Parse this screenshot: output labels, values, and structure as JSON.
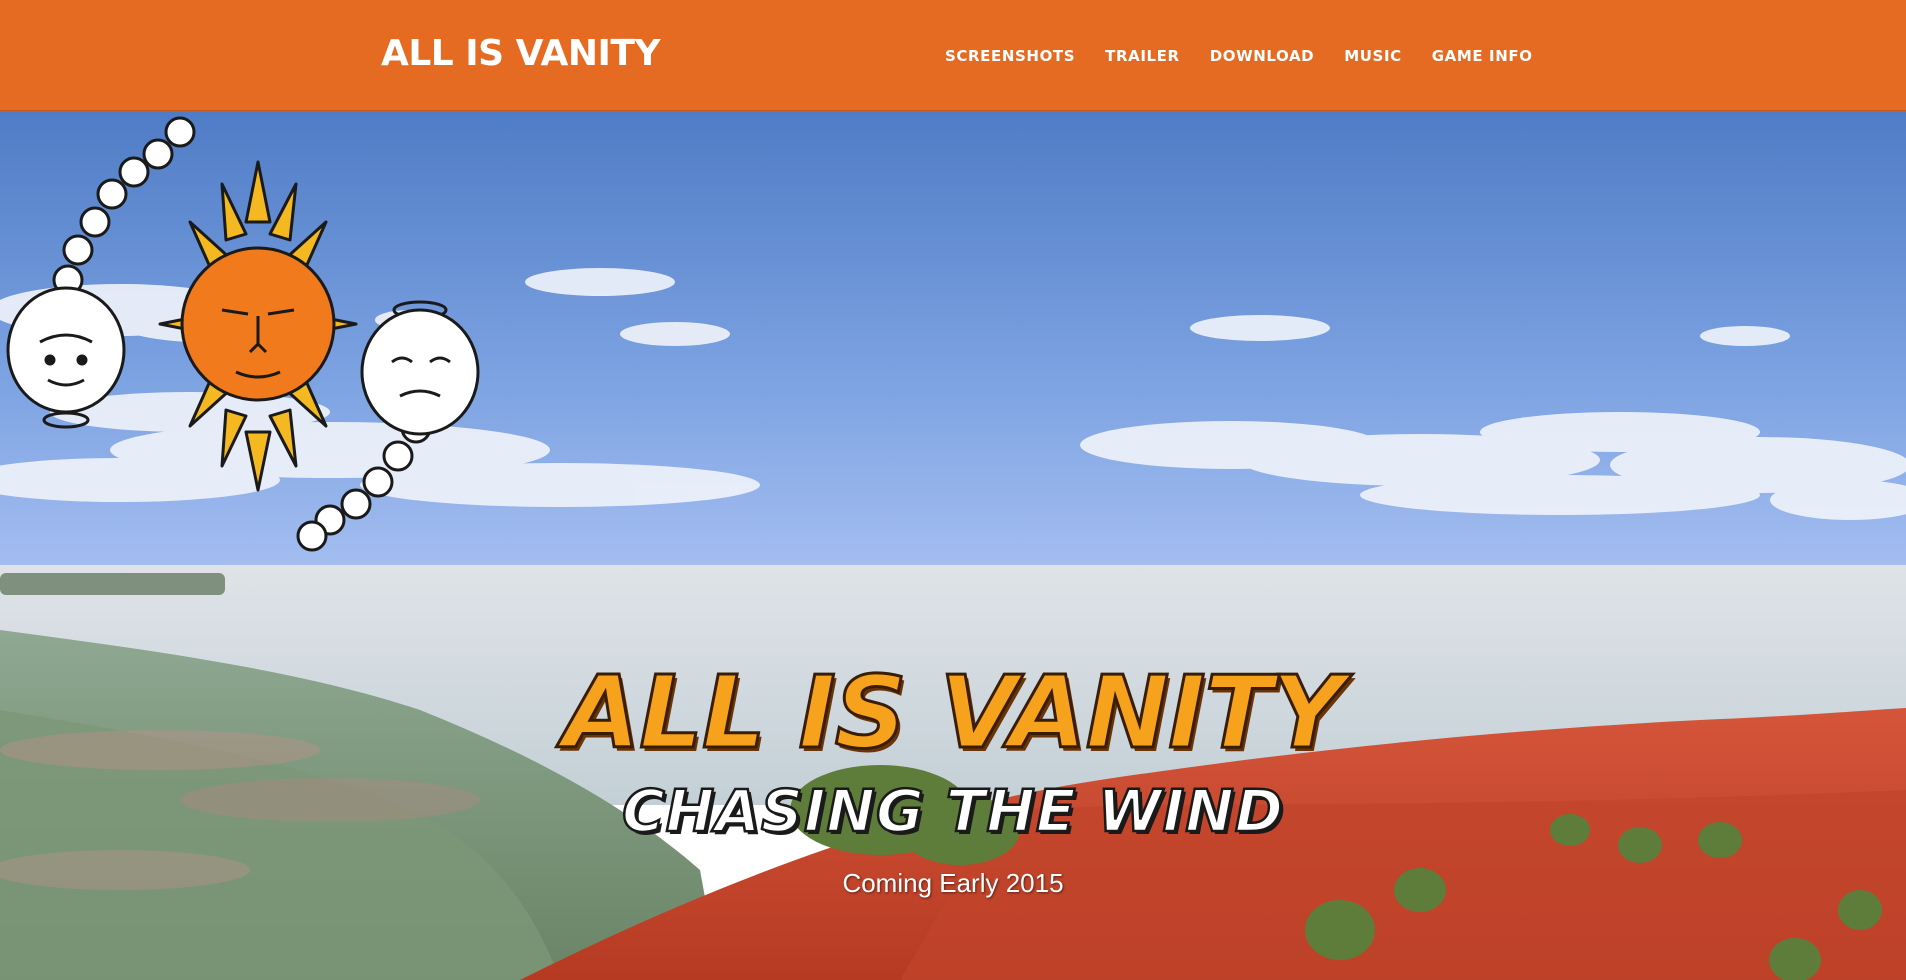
{
  "navbar": {
    "brand": "ALL IS VANITY",
    "links": [
      {
        "label": "SCREENSHOTS"
      },
      {
        "label": "TRAILER"
      },
      {
        "label": "DOWNLOAD"
      },
      {
        "label": "MUSIC"
      },
      {
        "label": "GAME INFO"
      }
    ],
    "background_color": "#e56a22"
  },
  "hero": {
    "logo_icon": "sun-face-with-chained-cherubs-logo",
    "title": "ALL IS VANITY",
    "subtitle": "CHASING THE WIND",
    "tagline": "Coming Early 2015",
    "colors": {
      "sky": "#6f96d8",
      "sea": "#cdd6dc",
      "red_hills": "#c2452a",
      "green_hills": "#6d8b6a",
      "title_orange": "#f7a21c"
    }
  }
}
